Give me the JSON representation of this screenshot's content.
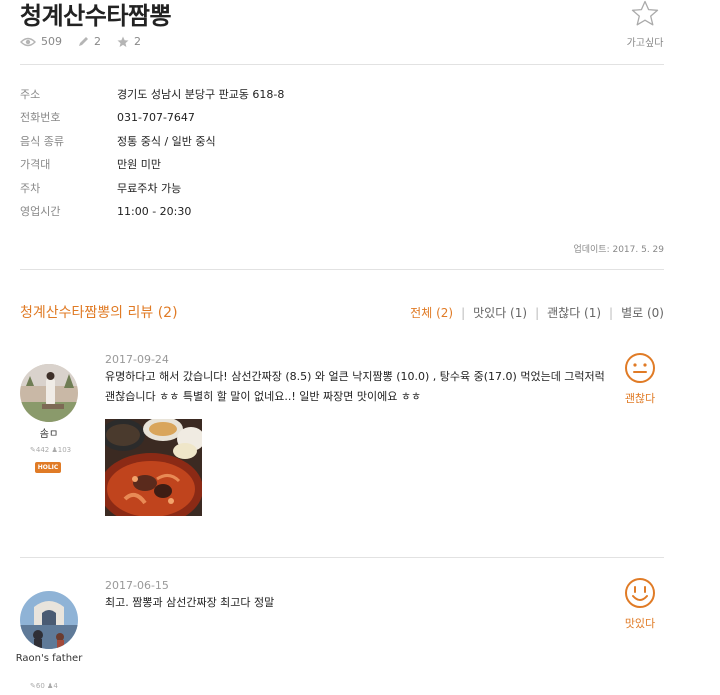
{
  "restaurant": {
    "name": "청계산수타짬뽕",
    "views": "509",
    "reviews_count": "2",
    "wishes_count": "2",
    "wish_label": "가고싶다"
  },
  "info": [
    {
      "label": "주소",
      "value": "경기도 성남시 분당구 판교동 618-8"
    },
    {
      "label": "전화번호",
      "value": "031-707-7647"
    },
    {
      "label": "음식 종류",
      "value": "정통 중식 / 일반 중식"
    },
    {
      "label": "가격대",
      "value": "만원 미만"
    },
    {
      "label": "주차",
      "value": "무료주차 가능"
    },
    {
      "label": "영업시간",
      "value": "11:00 - 20:30"
    }
  ],
  "updated": "업데이트: 2017. 5. 29",
  "reviews_section": {
    "title": "청계산수타짬뽕의 리뷰 (2)",
    "filters": [
      "전체 (2)",
      "맛있다 (1)",
      "괜찮다 (1)",
      "별로 (0)"
    ]
  },
  "reviews": [
    {
      "user": "솜ㅁ",
      "user_reviews": "442",
      "user_followers": "103",
      "badge": "HOLIC",
      "date": "2017-09-24",
      "text": "유명하다고 해서 갔습니다! 삼선간짜장 (8.5) 와 얼큰 낙지짬뽕 (10.0) , 탕수육 중(17.0) 먹었는데 그럭저럭 괜찮습니다 ㅎㅎ 특별히 할 말이 없네요..! 일반 짜장면 맛이에요 ㅎㅎ",
      "rating_label": "괜찮다"
    },
    {
      "user": "Raon's father",
      "user_reviews": "60",
      "user_followers": "4",
      "date": "2017-06-15",
      "text": "최고. 짬뽕과 삼선간짜장 최고다 정말",
      "rating_label": "맛있다"
    }
  ],
  "colors": {
    "accent": "#e07b26",
    "muted": "#888888",
    "divider": "#e2e2e2"
  },
  "icons": {
    "views": "eye-icon",
    "reviews": "pencil-icon",
    "wishes": "star-icon",
    "wish_button": "star-outline-icon",
    "rating_ok": "smile-face-icon",
    "rating_good": "big-smile-face-icon"
  }
}
